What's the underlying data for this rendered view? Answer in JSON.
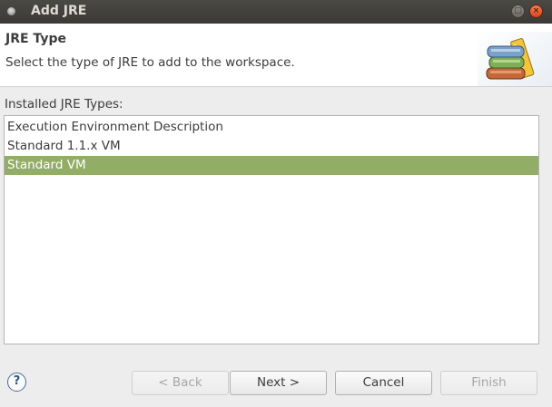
{
  "window": {
    "title": "Add JRE",
    "maximize_glyph": "□",
    "close_glyph": "×"
  },
  "header": {
    "title": "JRE Type",
    "description": "Select the type of JRE to add to the workspace.",
    "graphic_icon": "books-stack-icon"
  },
  "list": {
    "label": "Installed JRE Types:",
    "items": [
      {
        "label": "Execution Environment Description",
        "selected": false
      },
      {
        "label": "Standard 1.1.x VM",
        "selected": false
      },
      {
        "label": "Standard VM",
        "selected": true
      }
    ]
  },
  "footer": {
    "help_glyph": "?",
    "back": {
      "label": "< Back",
      "enabled": false
    },
    "next": {
      "label": "Next >",
      "enabled": true
    },
    "cancel": {
      "label": "Cancel",
      "enabled": true
    },
    "finish": {
      "label": "Finish",
      "enabled": false
    }
  },
  "colors": {
    "titlebar": "#3b3a36",
    "selection": "#92ad66",
    "close_button": "#e25a2c"
  }
}
